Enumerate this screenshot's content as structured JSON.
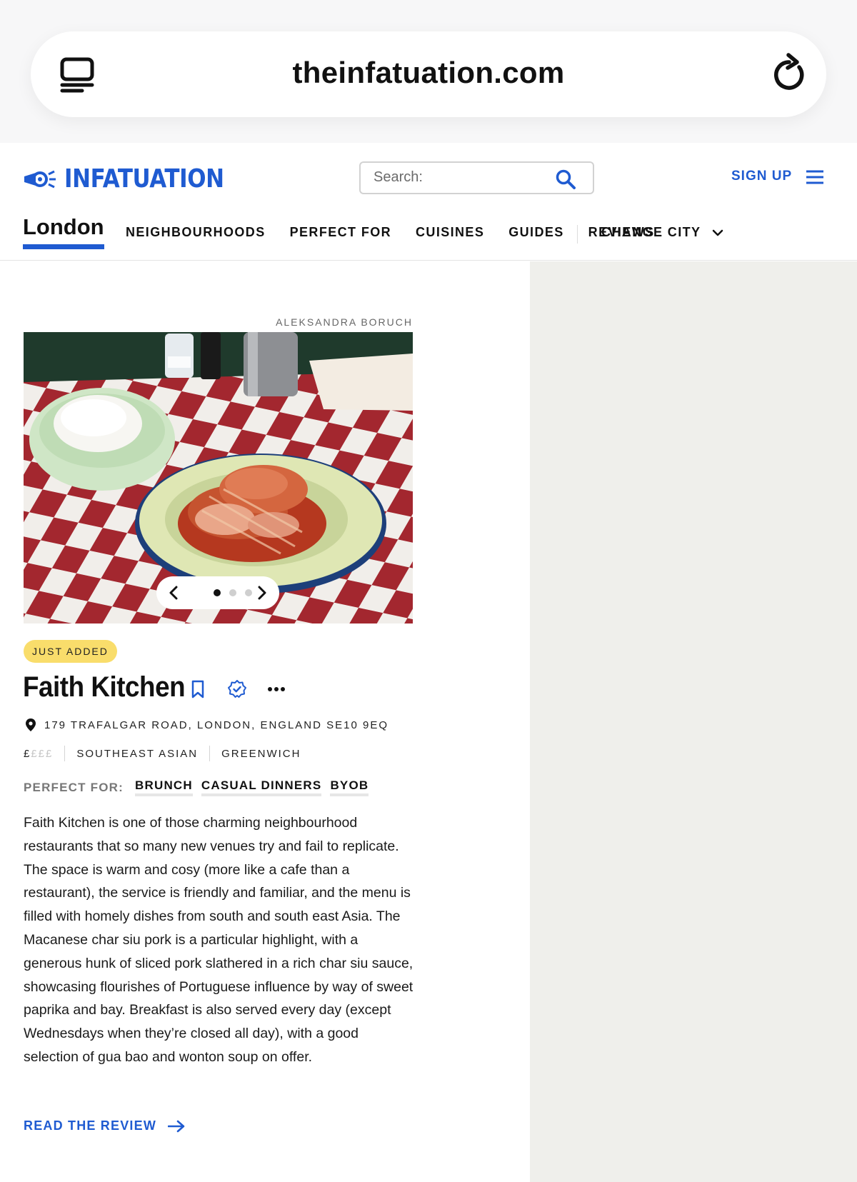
{
  "browser": {
    "url": "theinfatuation.com",
    "tabs_icon": "tabs-icon",
    "reload_icon": "reload-icon"
  },
  "header": {
    "logo_text": "INFATUATION",
    "search_placeholder": "Search:",
    "sign_up": "SIGN UP",
    "brand_color": "#1f5bd1"
  },
  "nav": {
    "city": "London",
    "items": [
      "NEIGHBOURHOODS",
      "PERFECT FOR",
      "CUISINES",
      "GUIDES",
      "REVIEWS"
    ],
    "change_city": "CHANGE CITY"
  },
  "listing": {
    "photo_credit": "ALEKSANDRA BORUCH",
    "carousel": {
      "total": 3,
      "active": 1
    },
    "badge": "JUST ADDED",
    "name": "Faith Kitchen",
    "address": "179 TRAFALGAR ROAD, LONDON, ENGLAND SE10 9EQ",
    "price_active": "£",
    "price_inactive": "£££",
    "cuisine": "SOUTHEAST ASIAN",
    "neighbourhood": "GREENWICH",
    "perfect_for_label": "PERFECT FOR:",
    "perfect_for": [
      "BRUNCH",
      "CASUAL DINNERS",
      "BYOB"
    ],
    "description": "Faith Kitchen is one of those charming neighbourhood restaurants that so many new venues try and fail to replicate. The space is warm and cosy (more like a cafe than a restaurant), the service is friendly and familiar, and the menu is filled with homely dishes from south and south east Asia. The Macanese char siu pork is a particular highlight, with a generous hunk of sliced pork slathered in a rich char siu sauce, showcasing flourishes of Portuguese influence by way of sweet paprika and bay. Breakfast is also served every day (except Wednesdays when they’re closed all day), with a good selection of gua bao and wonton soup on offer.",
    "read_review": "READ THE REVIEW"
  }
}
